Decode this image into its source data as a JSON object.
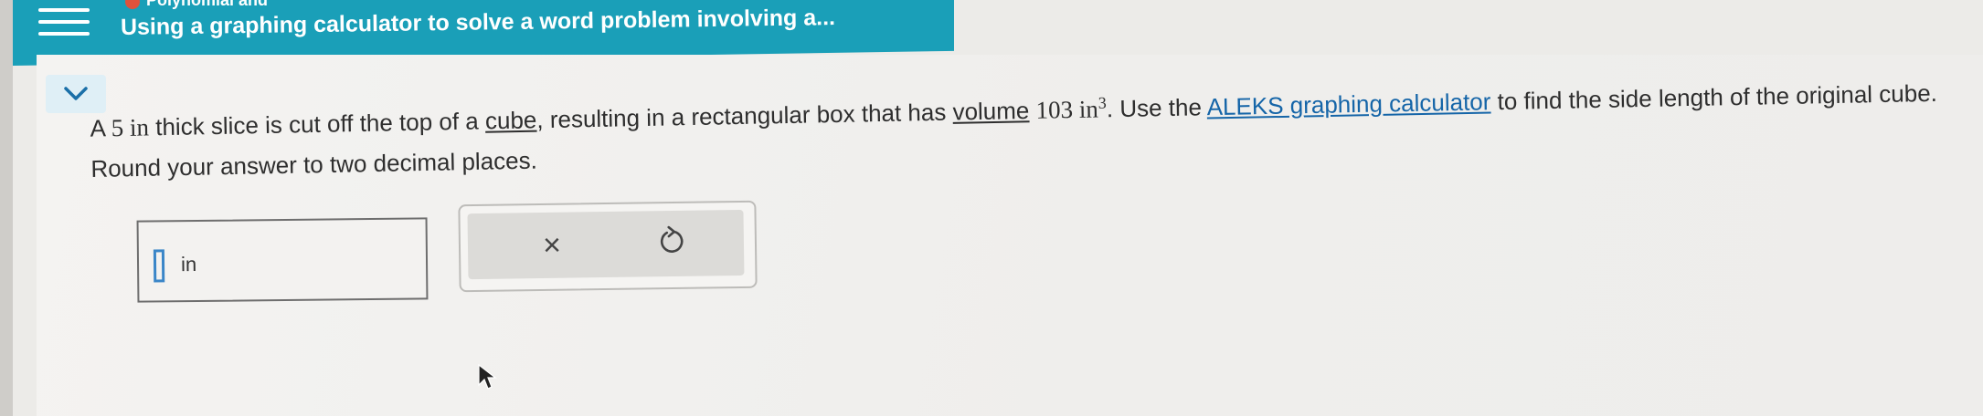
{
  "header": {
    "title": "Using a graphing calculator to solve a word problem involving a...",
    "subtitle": "Polynomial and"
  },
  "question": {
    "text_1": "A",
    "thickness": "5 in",
    "text_2": "thick slice is cut off the top of a",
    "cube_link": "cube",
    "text_3": ", resulting in a rectangular box that has",
    "volume_link": "volume",
    "volume_value": "103 in",
    "volume_exp": "3",
    "text_4": ". Use the",
    "calculator_link": "ALEKS graphing calculator",
    "text_5": "to find the side length of the original cube. Round your answer to two decimal places."
  },
  "answer": {
    "unit": "in",
    "value": ""
  },
  "actions": {
    "clear_symbol": "×",
    "undo_icon": "undo-icon"
  },
  "colors": {
    "header_teal": "#1a9fb8",
    "link_blue": "#1565a8",
    "cursor_blue": "#3a86c8"
  }
}
